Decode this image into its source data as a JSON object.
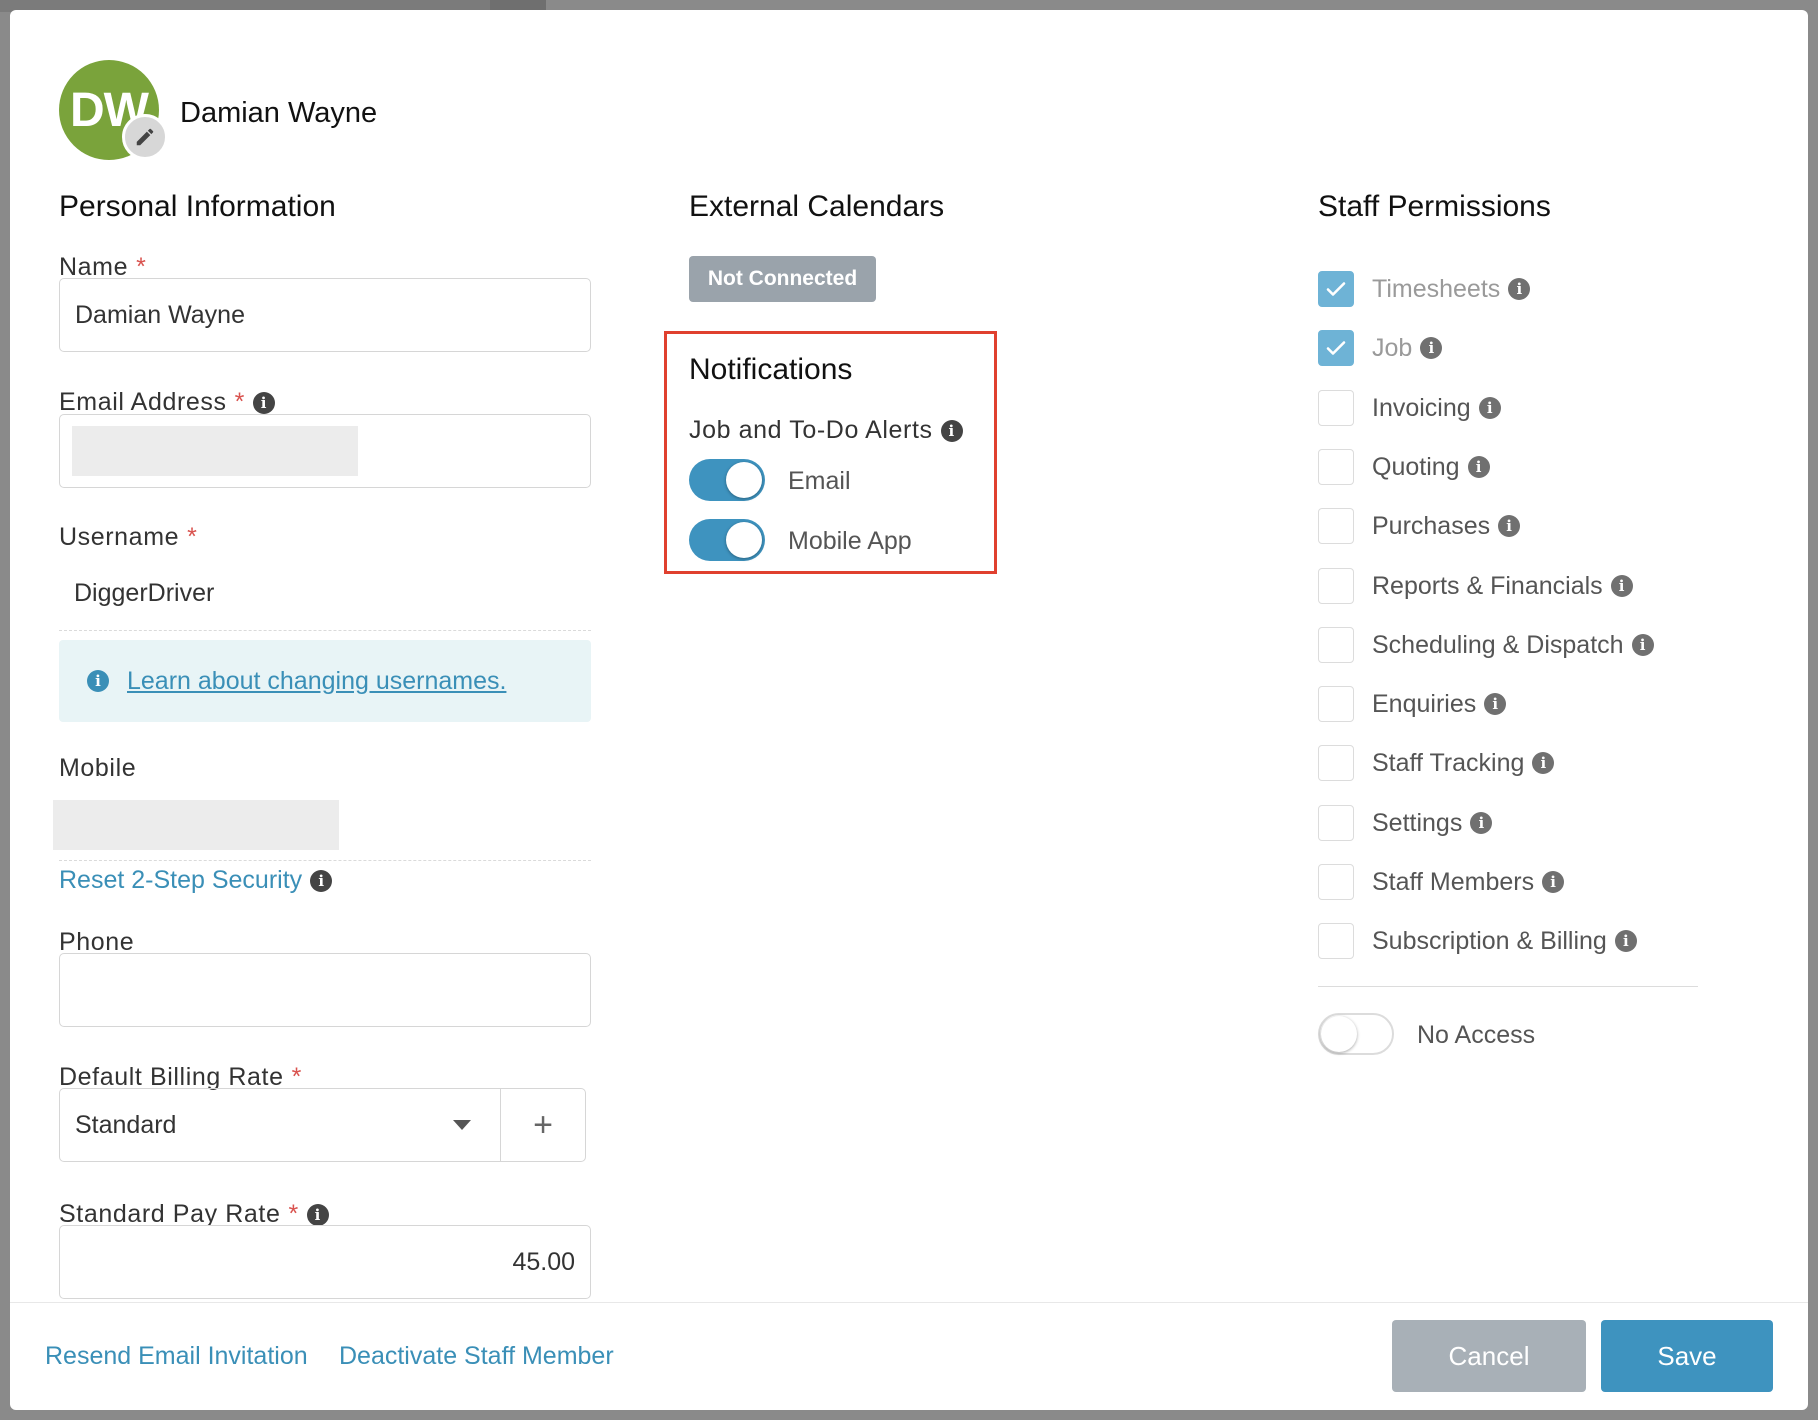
{
  "profile": {
    "initials": "DW",
    "name": "Damian Wayne"
  },
  "personal": {
    "title": "Personal Information",
    "name_label": "Name",
    "name_value": "Damian Wayne",
    "email_label": "Email Address",
    "username_label": "Username",
    "username_value": "DiggerDriver",
    "username_help": "Learn about changing usernames.",
    "mobile_label": "Mobile",
    "reset_security": "Reset 2-Step Security",
    "phone_label": "Phone",
    "phone_value": "",
    "billing_label": "Default Billing Rate",
    "billing_value": "Standard",
    "plus": "+",
    "pay_label": "Standard Pay Rate",
    "pay_value": "45.00",
    "required_mark": "*"
  },
  "calendars": {
    "title": "External Calendars",
    "status": "Not Connected"
  },
  "notifications": {
    "title": "Notifications",
    "alerts_label": "Job and To-Do Alerts",
    "email_label": "Email",
    "email_on": true,
    "mobile_label": "Mobile App",
    "mobile_on": true
  },
  "permissions": {
    "title": "Staff Permissions",
    "items": [
      {
        "label": "Timesheets",
        "checked": true
      },
      {
        "label": "Job",
        "checked": true
      },
      {
        "label": "Invoicing",
        "checked": false
      },
      {
        "label": "Quoting",
        "checked": false
      },
      {
        "label": "Purchases",
        "checked": false
      },
      {
        "label": "Reports & Financials",
        "checked": false
      },
      {
        "label": "Scheduling & Dispatch",
        "checked": false
      },
      {
        "label": "Enquiries",
        "checked": false
      },
      {
        "label": "Staff Tracking",
        "checked": false
      },
      {
        "label": "Settings",
        "checked": false
      },
      {
        "label": "Staff Members",
        "checked": false
      },
      {
        "label": "Subscription & Billing",
        "checked": false
      }
    ],
    "no_access_label": "No Access",
    "no_access_on": false
  },
  "footer": {
    "resend": "Resend Email Invitation",
    "deactivate": "Deactivate Staff Member",
    "cancel": "Cancel",
    "save": "Save"
  },
  "colors": {
    "accent": "#3e93bf",
    "avatar": "#7aa33b",
    "highlight_border": "#e0402f",
    "required": "#d9534f"
  },
  "icons": {
    "avatar_edit": "pencil-icon",
    "info": "info-icon",
    "check": "check-icon",
    "dropdown": "chevron-down-icon"
  }
}
